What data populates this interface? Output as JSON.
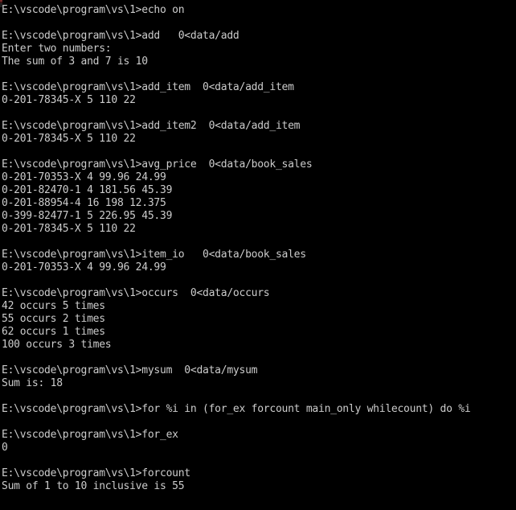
{
  "window": {
    "app_name": "Command Prompt",
    "background_color": "#000000",
    "foreground_color": "#cccccc",
    "prompt": "E:\\vscode\\program\\vs\\1>"
  },
  "console": {
    "lines": [
      "E:\\vscode\\program\\vs\\1>echo on",
      "",
      "E:\\vscode\\program\\vs\\1>add   0<data/add",
      "Enter two numbers:",
      "The sum of 3 and 7 is 10",
      "",
      "E:\\vscode\\program\\vs\\1>add_item  0<data/add_item",
      "0-201-78345-X 5 110 22",
      "",
      "E:\\vscode\\program\\vs\\1>add_item2  0<data/add_item",
      "0-201-78345-X 5 110 22",
      "",
      "E:\\vscode\\program\\vs\\1>avg_price  0<data/book_sales",
      "0-201-70353-X 4 99.96 24.99",
      "0-201-82470-1 4 181.56 45.39",
      "0-201-88954-4 16 198 12.375",
      "0-399-82477-1 5 226.95 45.39",
      "0-201-78345-X 5 110 22",
      "",
      "E:\\vscode\\program\\vs\\1>item_io   0<data/book_sales",
      "0-201-70353-X 4 99.96 24.99",
      "",
      "E:\\vscode\\program\\vs\\1>occurs  0<data/occurs",
      "42 occurs 5 times",
      "55 occurs 2 times",
      "62 occurs 1 times",
      "100 occurs 3 times",
      "",
      "E:\\vscode\\program\\vs\\1>mysum  0<data/mysum",
      "Sum is: 18",
      "",
      "E:\\vscode\\program\\vs\\1>for %i in (for_ex forcount main_only whilecount) do %i",
      "",
      "E:\\vscode\\program\\vs\\1>for_ex",
      "0",
      "",
      "E:\\vscode\\program\\vs\\1>forcount",
      "Sum of 1 to 10 inclusive is 55"
    ]
  }
}
